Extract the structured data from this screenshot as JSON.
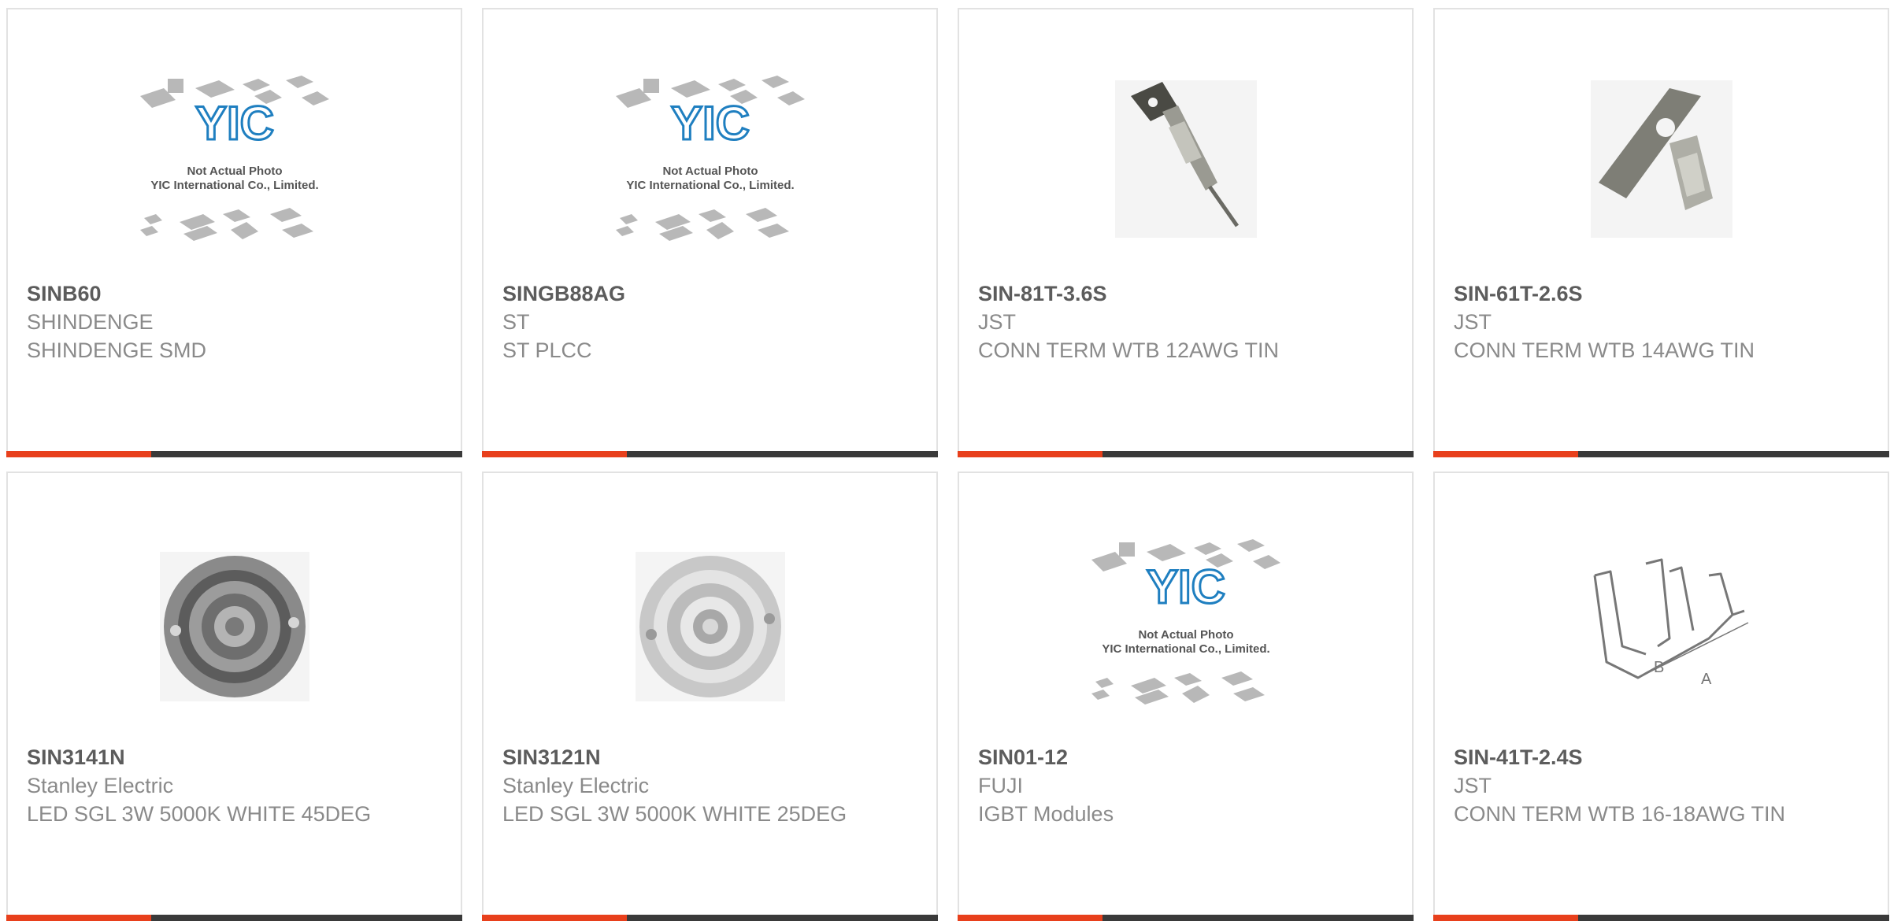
{
  "products": [
    {
      "part": "SINB60",
      "manufacturer": "SHINDENGE",
      "description": "SHINDENGE SMD",
      "image": "yic-placeholder",
      "placeholder_lines": [
        "Not Actual Photo",
        "YIC International Co., Limited."
      ]
    },
    {
      "part": "SINGB88AG",
      "manufacturer": "ST",
      "description": "ST PLCC",
      "image": "yic-placeholder",
      "placeholder_lines": [
        "Not Actual Photo",
        "YIC International Co., Limited."
      ]
    },
    {
      "part": "SIN-81T-3.6S",
      "manufacturer": "JST",
      "description": "CONN TERM WTB 12AWG TIN",
      "image": "crimp-terminal-photo"
    },
    {
      "part": "SIN-61T-2.6S",
      "manufacturer": "JST",
      "description": "CONN TERM WTB 14AWG TIN",
      "image": "crimp-terminal-photo"
    },
    {
      "part": "SIN3141N",
      "manufacturer": "Stanley Electric",
      "description": "LED SGL 3W 5000K WHITE 45DEG",
      "image": "led-lens-photo"
    },
    {
      "part": "SIN3121N",
      "manufacturer": "Stanley Electric",
      "description": "LED SGL 3W 5000K WHITE 25DEG",
      "image": "led-lens-photo"
    },
    {
      "part": "SIN01-12",
      "manufacturer": "FUJI",
      "description": "IGBT Modules",
      "image": "yic-placeholder",
      "placeholder_lines": [
        "Not Actual Photo",
        "YIC International Co., Limited."
      ]
    },
    {
      "part": "SIN-41T-2.4S",
      "manufacturer": "JST",
      "description": "CONN TERM WTB 16-18AWG TIN",
      "image": "terminal-diagram",
      "diagram_labels": [
        "B",
        "A"
      ]
    }
  ],
  "colors": {
    "accent": "#e8401c",
    "bar": "#3a3a3a",
    "border": "#e2e2e2",
    "part_text": "#5c5c5c",
    "text": "#8a8a8a",
    "logo": "#1f7fc0"
  }
}
